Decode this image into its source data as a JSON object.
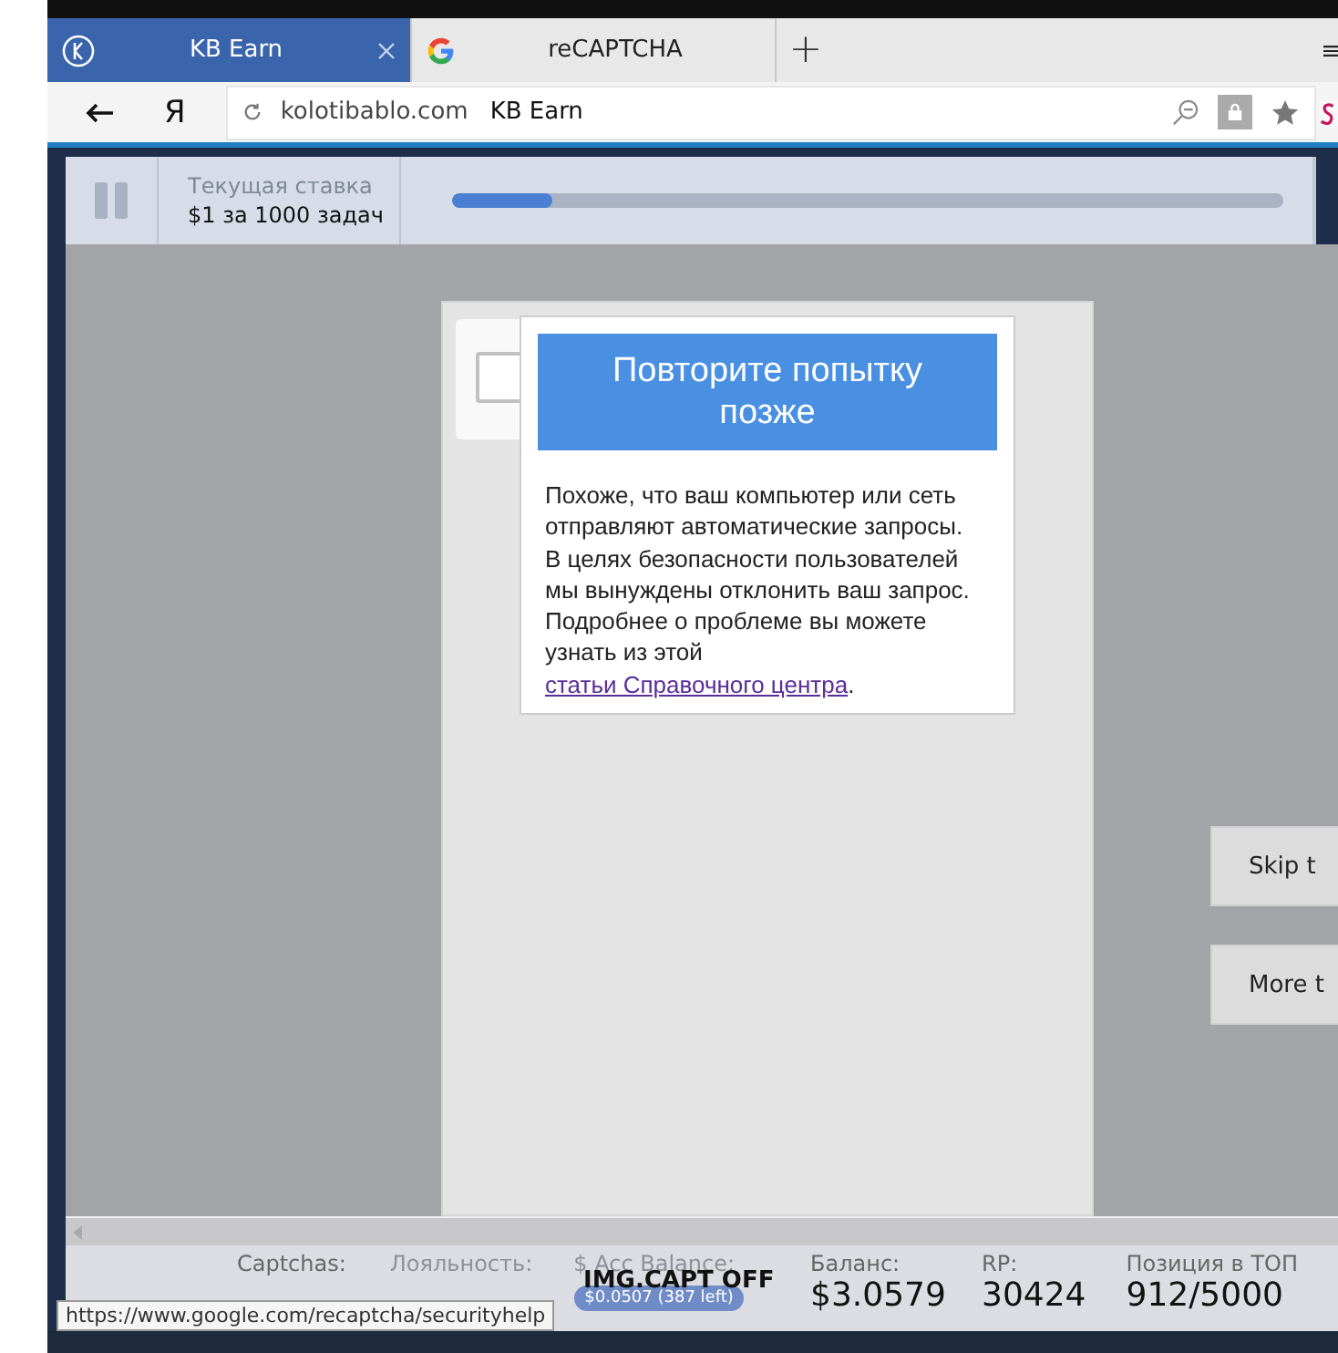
{
  "tabs": [
    {
      "label": "KB Earn",
      "kind": "kb",
      "selected": true
    },
    {
      "label": "reCAPTCHA",
      "kind": "google",
      "selected": false
    }
  ],
  "new_tab": "+",
  "address_bar": {
    "yandex": "Я",
    "url": "kolotibablo.com",
    "page_title": "KB Earn"
  },
  "header": {
    "rate_label": "Текущая ставка",
    "rate_value": "$1 за 1000 задач",
    "progress": {
      "level": 0.12
    }
  },
  "captcha_checkbox": {
    "checked": false
  },
  "captcha_error": {
    "title": "Повторите попытку позже",
    "body": "Похоже, что ваш компьютер или сеть отправляют автоматические запросы. В целях безопасности пользователей мы вынуждены отклонить ваш запрос. Подробнее о проблеме вы можете узнать из этой ",
    "link": "статьи Справочного центра",
    "end": "."
  },
  "side_buttons": [
    "Skip t",
    "More t"
  ],
  "stats": [
    {
      "label": "Captchas:",
      "kind": "plain",
      "faded": false
    },
    {
      "label": "Лояльность:",
      "kind": "plain",
      "faded": true
    },
    {
      "label": "$ Acc Balance:",
      "value": "$0.0507 (387 left)",
      "kind": "pill",
      "faded": true
    },
    {
      "label": "Баланс:",
      "value": "$3.0579",
      "kind": "plain",
      "faded": false
    },
    {
      "label": "RP:",
      "value": "30424",
      "kind": "plain",
      "faded": false
    },
    {
      "label": "Позиция в ТОП",
      "value": "912/5000",
      "kind": "plain",
      "faded": false
    }
  ],
  "mode_overlay": "IMG.CAPT OFF",
  "status_url": "https://www.google.com/recaptcha/securityhelp"
}
